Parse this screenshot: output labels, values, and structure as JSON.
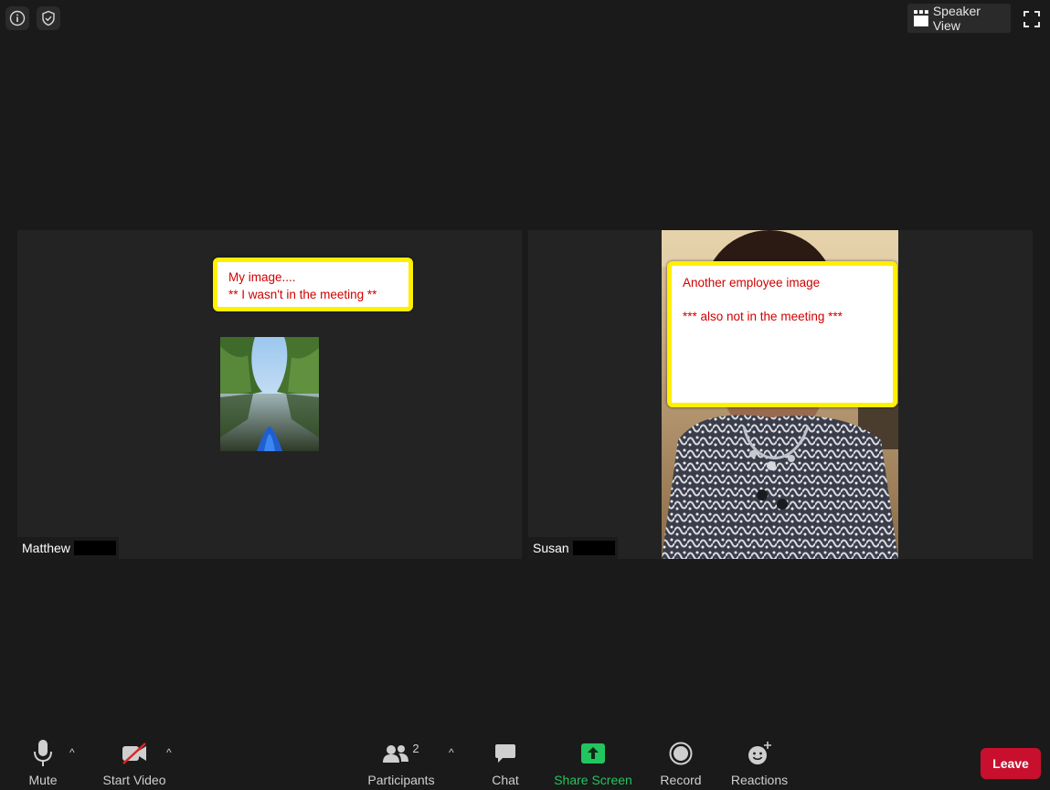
{
  "top": {
    "speaker_view_label": "Speaker View"
  },
  "tiles": [
    {
      "name": "Matthew",
      "note_lines": [
        "My image....",
        "** I wasn't in the meeting **"
      ]
    },
    {
      "name": "Susan",
      "note_lines": [
        "Another employee image",
        "*** also not in the meeting ***"
      ]
    }
  ],
  "toolbar": {
    "mute_label": "Mute",
    "start_video_label": "Start Video",
    "participants_label": "Participants",
    "participants_count": "2",
    "chat_label": "Chat",
    "share_screen_label": "Share Screen",
    "record_label": "Record",
    "reactions_label": "Reactions",
    "leave_label": "Leave"
  },
  "colors": {
    "share_screen": "#22c55e",
    "leave": "#c8102e",
    "note_border": "#ffef00",
    "note_text": "#d00000"
  }
}
